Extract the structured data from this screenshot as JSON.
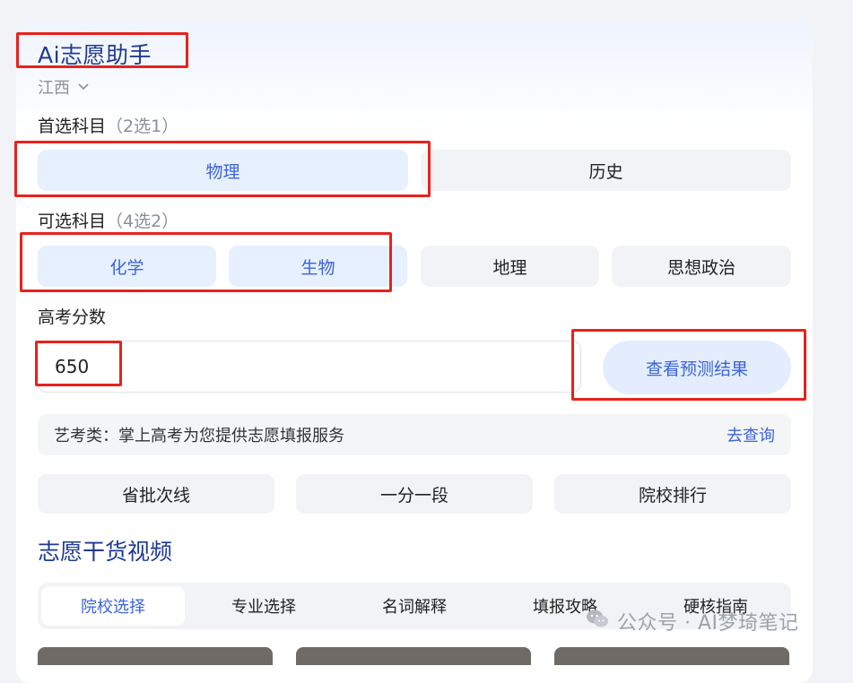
{
  "header": {
    "title": "Ai志愿助手",
    "province": "江西"
  },
  "first_subject": {
    "label": "首选科目",
    "hint": "（2选1）",
    "options": [
      {
        "label": "物理",
        "selected": true
      },
      {
        "label": "历史",
        "selected": false
      }
    ]
  },
  "optional_subject": {
    "label": "可选科目",
    "hint": "（4选2）",
    "options": [
      {
        "label": "化学",
        "selected": true
      },
      {
        "label": "生物",
        "selected": true
      },
      {
        "label": "地理",
        "selected": false
      },
      {
        "label": "思想政治",
        "selected": false
      }
    ]
  },
  "score": {
    "label": "高考分数",
    "value": "650"
  },
  "predict_button": "查看预测结果",
  "art_bar": {
    "text": "艺考类：掌上高考为您提供志愿填报服务",
    "link": "去查询"
  },
  "quick_links": [
    "省批次线",
    "一分一段",
    "院校排行"
  ],
  "video_section": {
    "title": "志愿干货视频",
    "tabs": [
      {
        "label": "院校选择",
        "active": true
      },
      {
        "label": "专业选择",
        "active": false
      },
      {
        "label": "名词解释",
        "active": false
      },
      {
        "label": "填报攻略",
        "active": false
      },
      {
        "label": "硬核指南",
        "active": false
      }
    ]
  },
  "watermark": "公众号 · AI梦琦笔记",
  "colors": {
    "accent": "#3c64d8",
    "title": "#1f3a93",
    "selected_bg": "#e6f0ff",
    "highlight_box": "#e8221c"
  }
}
